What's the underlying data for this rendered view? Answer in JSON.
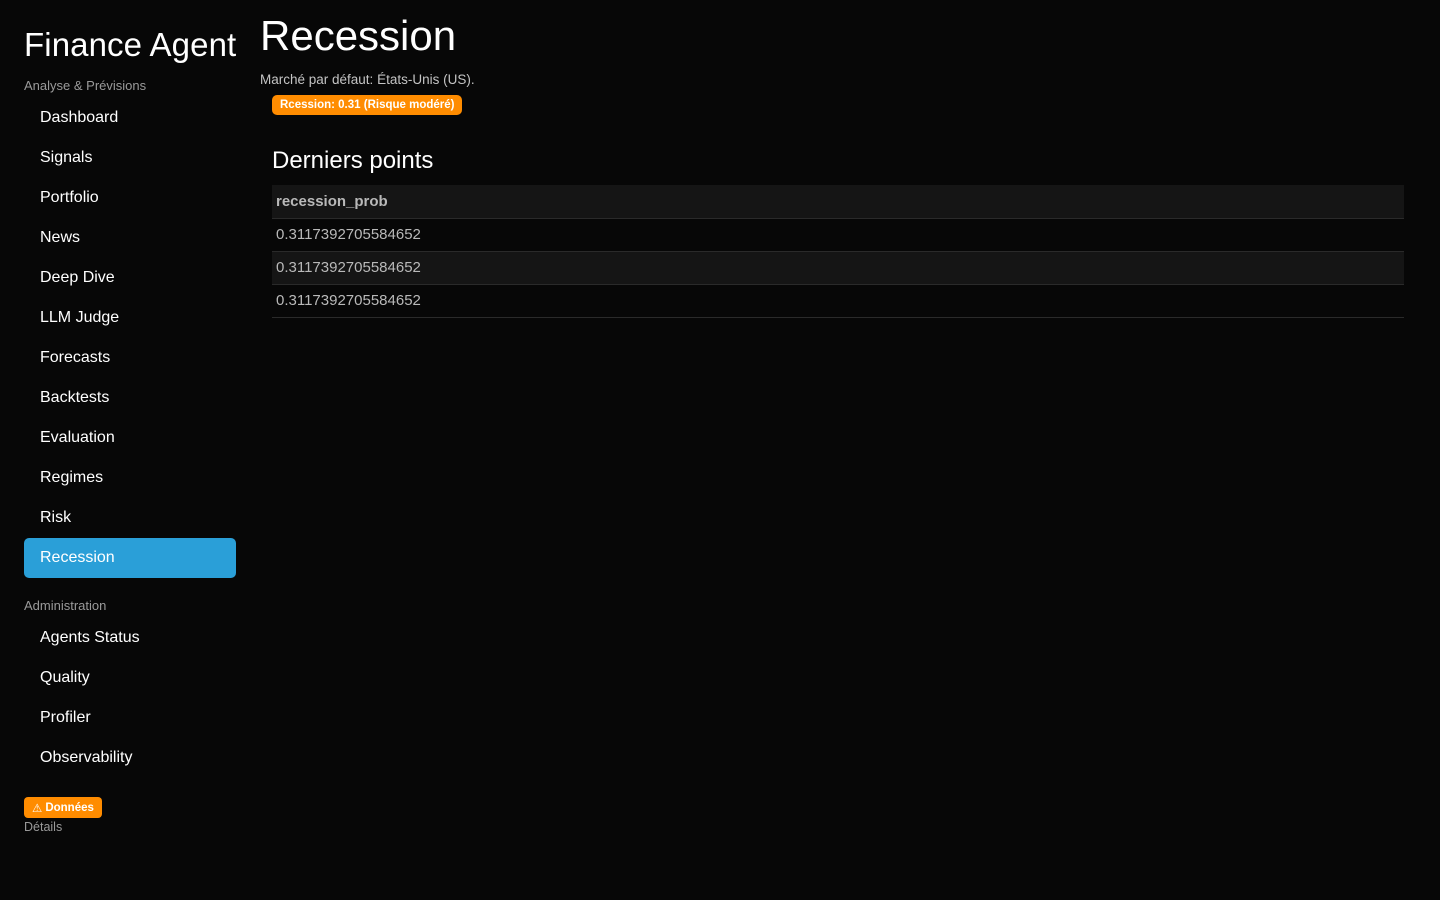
{
  "sidebar": {
    "app_title": "Finance Agent",
    "sections": [
      {
        "label": "Analyse & Prévisions",
        "items": [
          {
            "label": "Dashboard",
            "active": false
          },
          {
            "label": "Signals",
            "active": false
          },
          {
            "label": "Portfolio",
            "active": false
          },
          {
            "label": "News",
            "active": false
          },
          {
            "label": "Deep Dive",
            "active": false
          },
          {
            "label": "LLM Judge",
            "active": false
          },
          {
            "label": "Forecasts",
            "active": false
          },
          {
            "label": "Backtests",
            "active": false
          },
          {
            "label": "Evaluation",
            "active": false
          },
          {
            "label": "Regimes",
            "active": false
          },
          {
            "label": "Risk",
            "active": false
          },
          {
            "label": "Recession",
            "active": true
          }
        ]
      },
      {
        "label": "Administration",
        "items": [
          {
            "label": "Agents Status",
            "active": false
          },
          {
            "label": "Quality",
            "active": false
          },
          {
            "label": "Profiler",
            "active": false
          },
          {
            "label": "Observability",
            "active": false
          }
        ]
      }
    ],
    "data_badge": {
      "icon": "warning-icon",
      "glyph": "⚠",
      "label": "Données",
      "color": "#ff8c00"
    },
    "details_link": "Détails"
  },
  "main": {
    "page_title": "Recession",
    "market_caption": "Marché par défaut: États-Unis (US).",
    "recession_badge": {
      "label": "Rcession: 0.31 (Risque modéré)",
      "color": "#ff8c00"
    },
    "section_title": "Derniers points",
    "table": {
      "columns": [
        "recession_prob"
      ],
      "rows": [
        [
          "0.3117392705584652"
        ],
        [
          "0.3117392705584652"
        ],
        [
          "0.3117392705584652"
        ]
      ]
    }
  },
  "colors": {
    "background": "#070707",
    "accent": "#2a9fd8",
    "warning": "#ff8c00"
  }
}
